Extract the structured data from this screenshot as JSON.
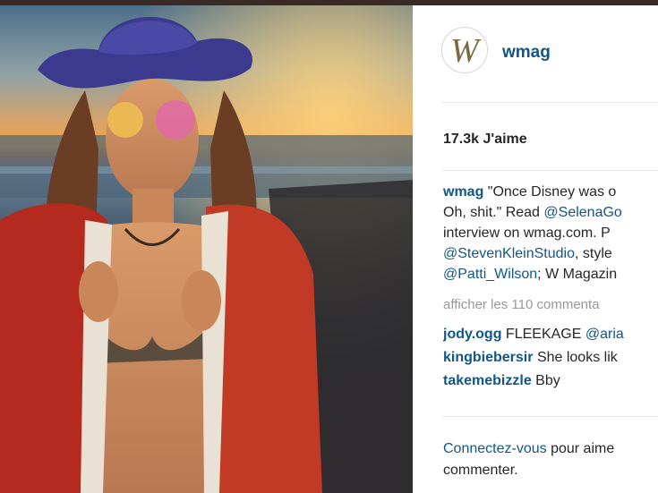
{
  "post": {
    "photo_alt": "Woman in cowboy hat and sunglasses at beach sunset",
    "account": {
      "username": "wmag",
      "avatar_letter": "W"
    },
    "likes_text": "17.3k J'aime",
    "caption": {
      "username": "wmag",
      "lines": [
        "\"Once Disney was o",
        "Oh, shit.\" Read ",
        "interview on wmag.com. P",
        ", style",
        "; W Magazin"
      ],
      "mentions": [
        "@SelenaGo",
        "@StevenKleinStudio",
        "@Patti_Wilson"
      ]
    },
    "view_all_comments": "afficher les 110 commenta",
    "comments": [
      {
        "username": "jody.ogg",
        "text": "FLEEKAGE ",
        "mention": "@aria"
      },
      {
        "username": "kingbiebersir",
        "text": "She looks lik",
        "mention": ""
      },
      {
        "username": "takemebizzle",
        "text": "Bby",
        "mention": ""
      }
    ],
    "footer": {
      "link": "Connectez-vous",
      "text": " pour aime",
      "line2": "commenter."
    }
  }
}
